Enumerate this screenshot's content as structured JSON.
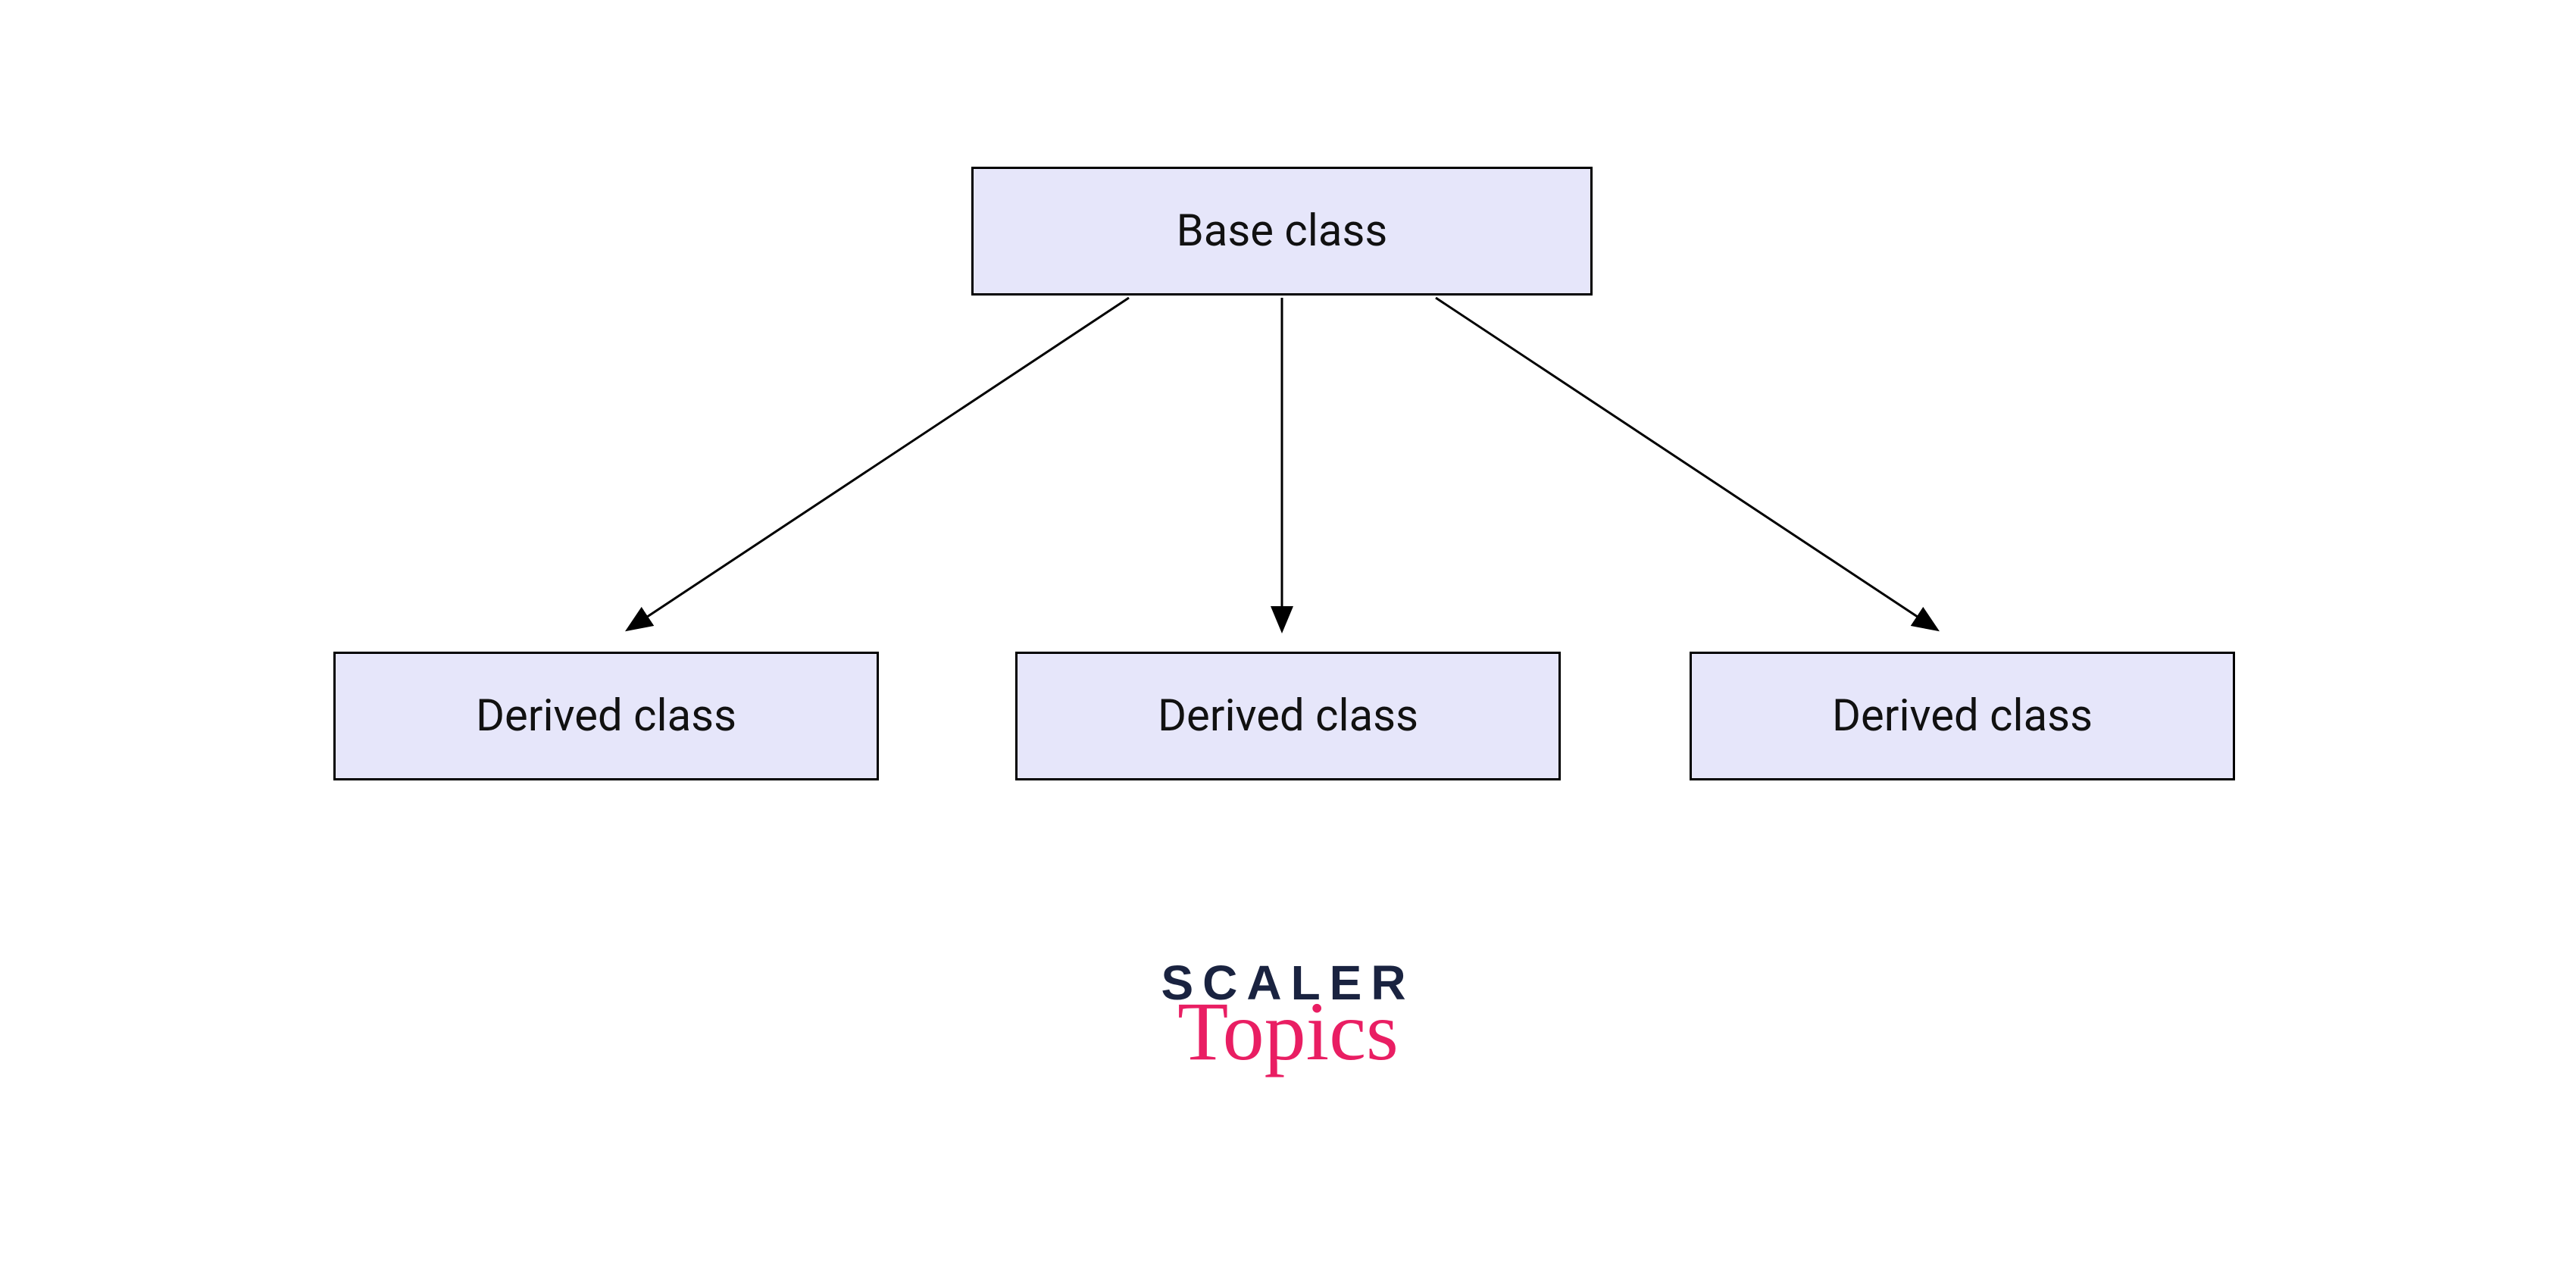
{
  "diagram": {
    "base": {
      "label": "Base class"
    },
    "derived": [
      {
        "label": "Derived class"
      },
      {
        "label": "Derived class"
      },
      {
        "label": "Derived class"
      }
    ]
  },
  "logo": {
    "line1": "SCALER",
    "line2": "Topics"
  },
  "colors": {
    "box_fill": "#e6e6fa",
    "box_stroke": "#000000",
    "logo_primary": "#1a2340",
    "logo_accent": "#e91e63"
  }
}
